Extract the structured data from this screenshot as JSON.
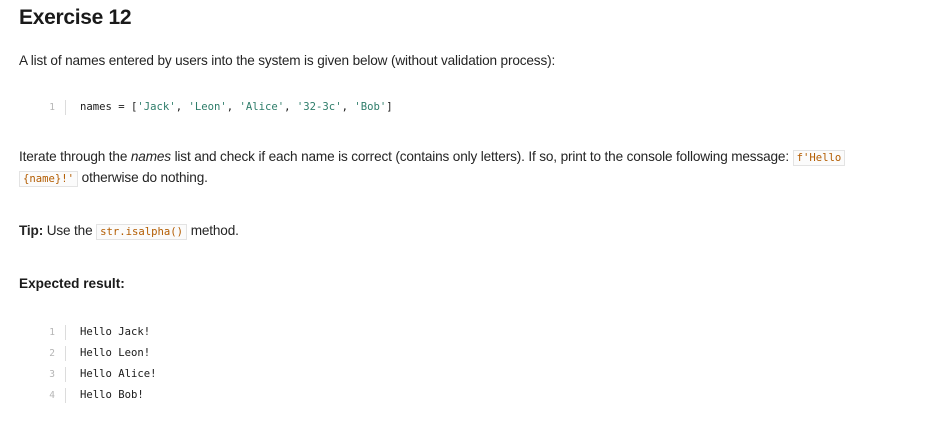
{
  "title": "Exercise 12",
  "intro": "A list of names entered by users into the system is given below (without validation process):",
  "code_names": {
    "line_number": "1",
    "var": "names",
    "op": " = [",
    "items": [
      "'Jack'",
      "'Leon'",
      "'Alice'",
      "'32-3c'",
      "'Bob'"
    ],
    "sep": ", ",
    "close": "]"
  },
  "task": {
    "before": "Iterate through the ",
    "emph": "names",
    "middle": " list and check if each name is correct (contains only letters). If so, print to the console following message: ",
    "code_line1": "f'Hello",
    "code_line2": "{name}!'",
    "after": " otherwise do nothing."
  },
  "tip": {
    "label": "Tip:",
    "before": " Use the ",
    "code": "str.isalpha()",
    "after": " method."
  },
  "expected_label": "Expected result:",
  "output_lines": [
    {
      "n": "1",
      "text": "Hello Jack!"
    },
    {
      "n": "2",
      "text": "Hello Leon!"
    },
    {
      "n": "3",
      "text": "Hello Alice!"
    },
    {
      "n": "4",
      "text": "Hello Bob!"
    }
  ]
}
